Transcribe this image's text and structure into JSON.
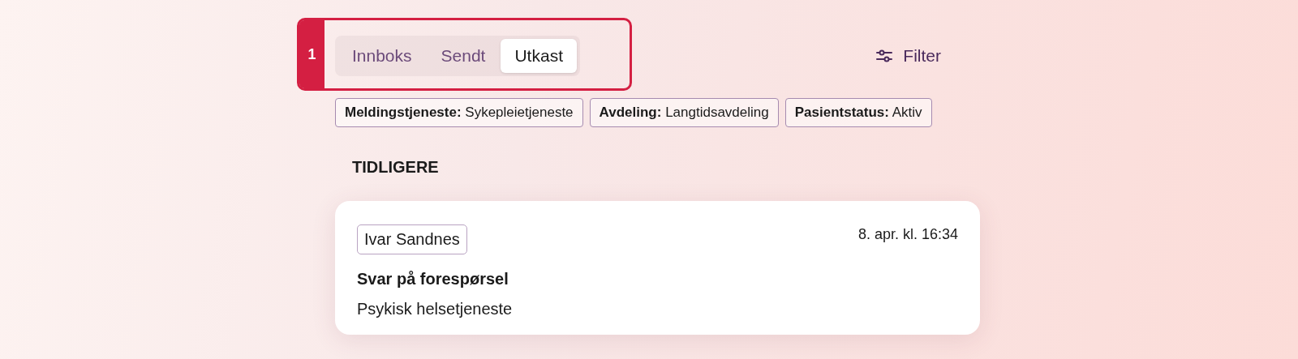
{
  "annotation": {
    "label": "1"
  },
  "tabs": [
    {
      "label": "Innboks",
      "selected": false
    },
    {
      "label": "Sendt",
      "selected": false
    },
    {
      "label": "Utkast",
      "selected": true
    }
  ],
  "filter_button": {
    "label": "Filter"
  },
  "active_filters": [
    "**Meldingstjeneste:** Sykepleietjeneste",
    "**Avdeling:** Langtidsavdeling",
    "**Pasientstatus:** Aktiv"
  ],
  "section_heading": "TIDLIGERE",
  "messages": [
    {
      "sender": "Ivar Sandnes",
      "time": "8. apr. kl. 16:34",
      "subject": "Svar på forespørsel",
      "service": "Psykisk helsetjeneste"
    }
  ]
}
